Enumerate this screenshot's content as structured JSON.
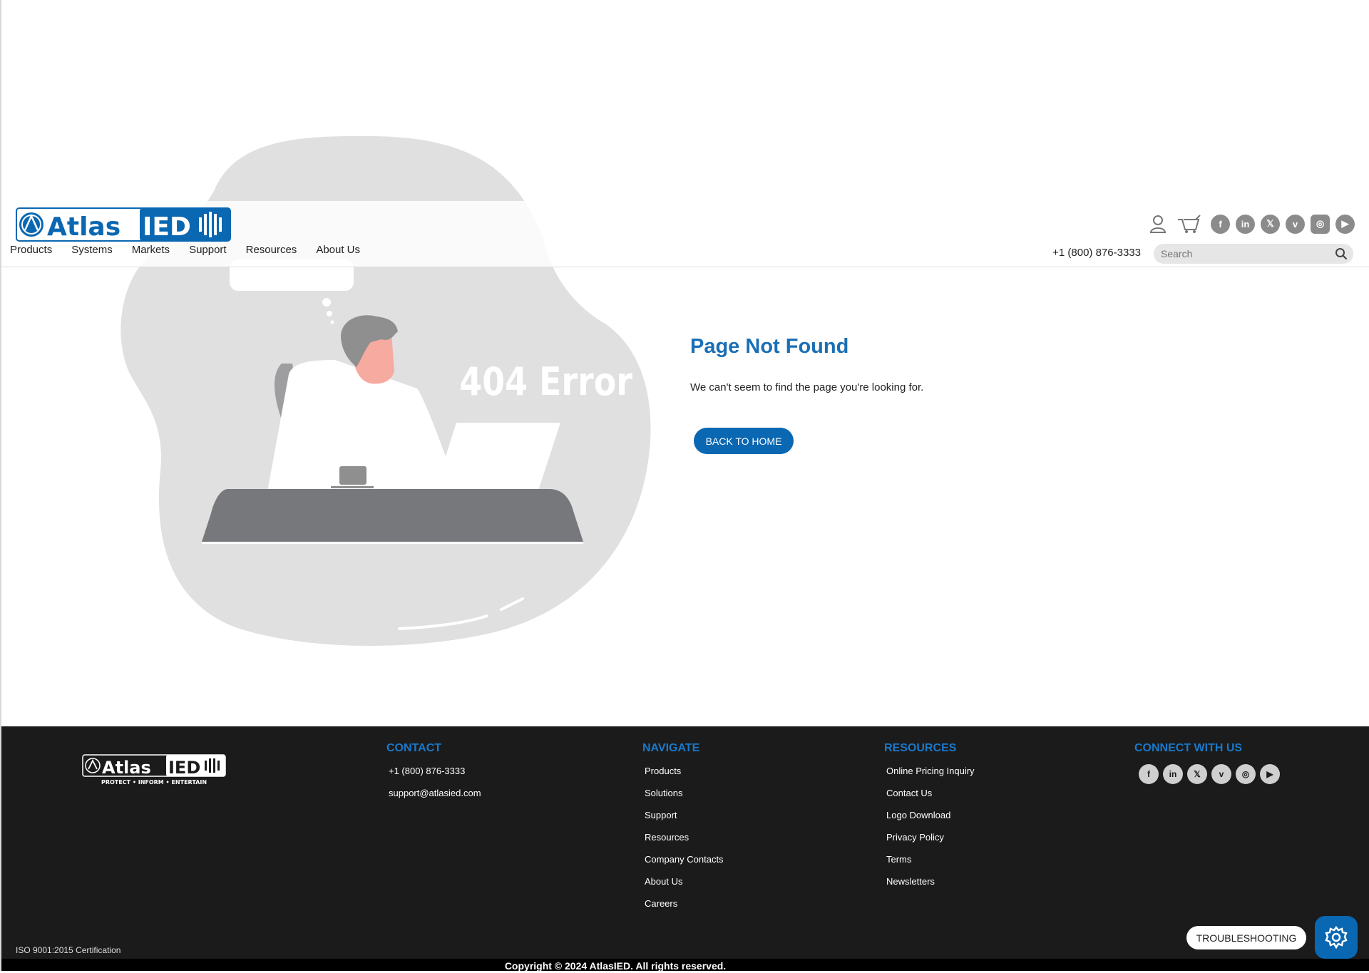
{
  "header": {
    "logo_text": "AtlasIED",
    "nav": [
      "Products",
      "Systems",
      "Markets",
      "Support",
      "Resources",
      "About Us"
    ],
    "phone": "+1 (800) 876-3333",
    "search_placeholder": "Search",
    "social": [
      "facebook",
      "linkedin",
      "x",
      "vimeo",
      "instagram",
      "youtube"
    ]
  },
  "illustration": {
    "text": "404 Error"
  },
  "main": {
    "title": "Page Not Found",
    "message": "We can't seem to find the page you're looking for.",
    "button": "BACK TO HOME"
  },
  "footer": {
    "logo_tagline": "PROTECT • INFORM • ENTERTAIN",
    "contact": {
      "heading": "CONTACT",
      "items": [
        "+1 (800) 876-3333",
        "support@atlasied.com"
      ]
    },
    "navigate": {
      "heading": "NAVIGATE",
      "items": [
        "Products",
        "Solutions",
        "Support",
        "Resources",
        "Company Contacts",
        "About Us",
        "Careers"
      ]
    },
    "resources": {
      "heading": "RESOURCES",
      "items": [
        "Online Pricing Inquiry",
        "Contact Us",
        "Logo Download",
        "Privacy Policy",
        "Terms",
        "Newsletters"
      ]
    },
    "connect": {
      "heading": "CONNECT WITH US"
    },
    "iso": "ISO 9001:2015 Certification",
    "copyright": "Copyright © 2024 AtlasIED. All rights reserved."
  },
  "widgets": {
    "troubleshooting": "TROUBLESHOOTING"
  },
  "colors": {
    "brand_blue": "#0a67b1",
    "heading_blue": "#1a6fb5",
    "footer_bg": "#1b1b1b",
    "blob": "#e0e0e0"
  }
}
